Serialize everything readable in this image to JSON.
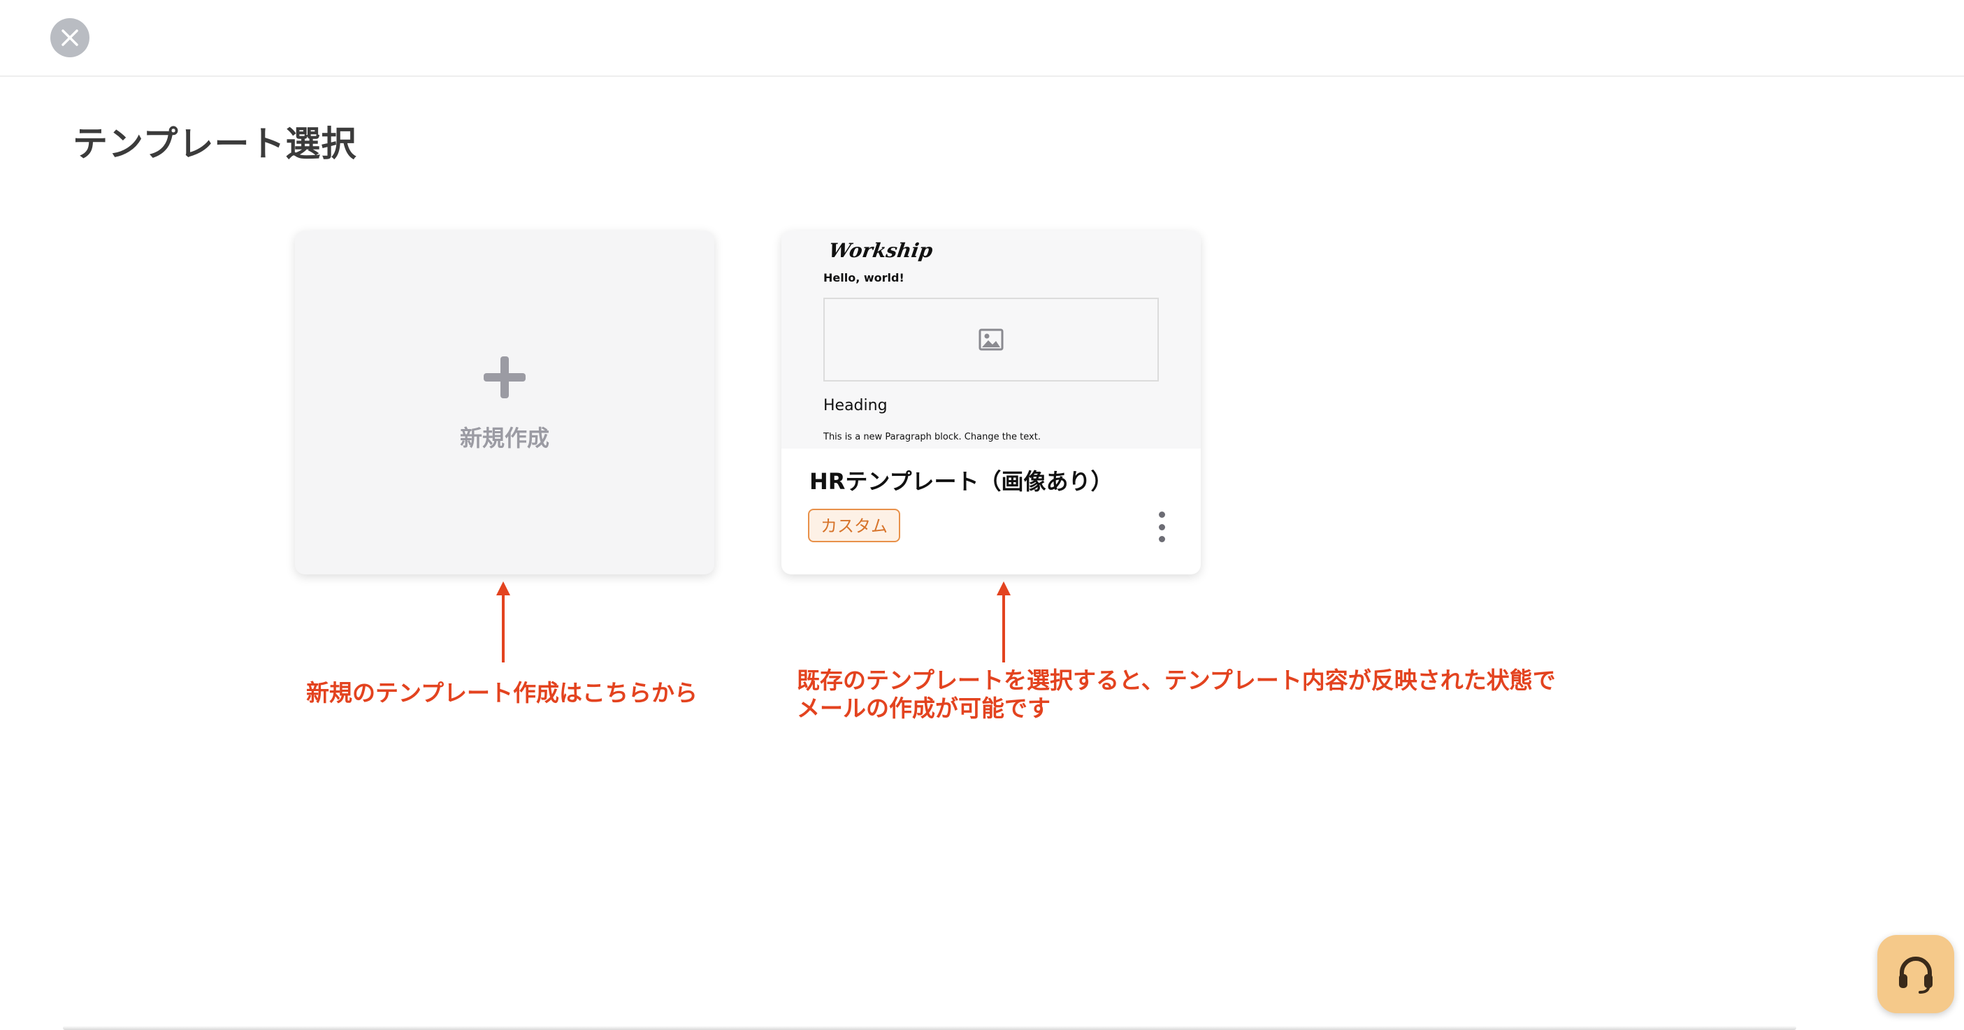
{
  "header": {
    "close_icon": "close-icon"
  },
  "page": {
    "title": "テンプレート選択"
  },
  "new_card": {
    "icon": "plus-icon",
    "label": "新規作成"
  },
  "template_card": {
    "preview": {
      "brand": "Workship",
      "greeting": "Hello, world!",
      "image_icon": "image-icon",
      "heading": "Heading",
      "paragraph": "This is a new Paragraph block. Change the text."
    },
    "title": "HRテンプレート（画像あり）",
    "badge": "カスタム",
    "more_icon": "more-vertical-icon"
  },
  "annotations": {
    "new_note": "新規のテンプレート作成はこちらから",
    "existing_note_line1": "既存のテンプレートを選択すると、テンプレート内容が反映された状態で",
    "existing_note_line2": "メールの作成が可能です"
  },
  "support": {
    "icon": "headset-icon"
  },
  "colors": {
    "accent_red": "#e3431f",
    "badge_orange": "#e8914a",
    "support_bg": "#f5c98a"
  }
}
